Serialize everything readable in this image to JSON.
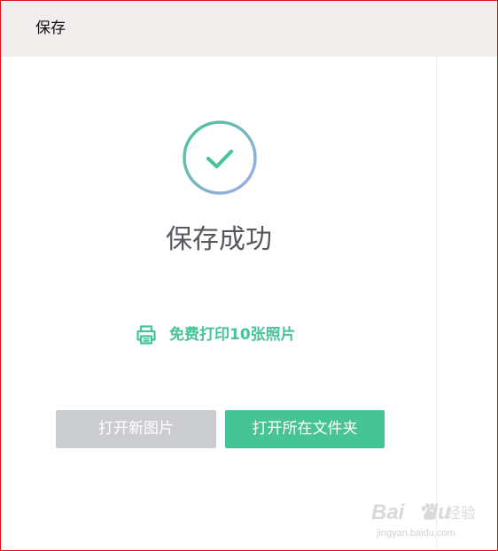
{
  "window": {
    "title": "保存"
  },
  "main": {
    "success_icon": "check-circle-icon",
    "success_title": "保存成功",
    "print_link": {
      "icon": "printer-icon",
      "label": "免费打印10张照片"
    },
    "buttons": {
      "open_image": "打开新图片",
      "open_folder": "打开所在文件夹"
    }
  },
  "watermark": {
    "brand": "Bai",
    "brand_suffix": "du",
    "name": "经验",
    "url": "jingyan.baidu.com"
  },
  "colors": {
    "accent": "#46c496",
    "titlebar_bg": "#f1eded",
    "disabled_button": "#cbccd0",
    "border": "#d7141a",
    "heading_text": "#55585c"
  }
}
